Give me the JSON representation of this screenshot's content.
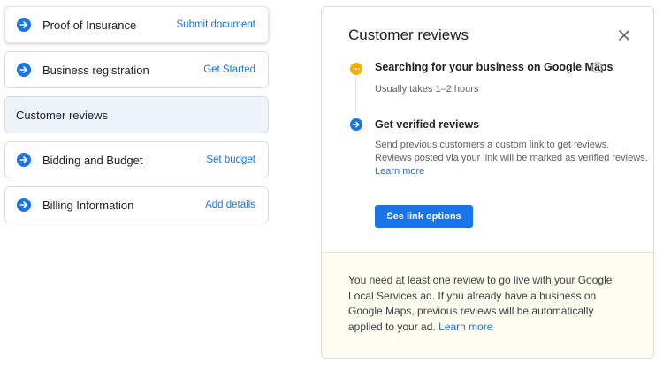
{
  "steps": [
    {
      "label": "Proof of Insurance",
      "action": "Submit document",
      "icon": "arrow-right-circle-icon"
    },
    {
      "label": "Business registration",
      "action": "Get Started",
      "icon": "arrow-right-circle-icon"
    },
    {
      "label": "Customer reviews",
      "action": ""
    },
    {
      "label": "Bidding and Budget",
      "action": "Set budget",
      "icon": "arrow-right-circle-icon"
    },
    {
      "label": "Billing Information",
      "action": "Add details",
      "icon": "arrow-right-circle-icon"
    }
  ],
  "panel": {
    "title": "Customer reviews",
    "close_icon": "close-icon",
    "searching": {
      "title": "Searching for your business on Google Maps",
      "subtitle": "Usually takes 1–2 hours",
      "icon": "pending-dots-icon",
      "help_icon": "help-circle-icon"
    },
    "verify": {
      "title": "Get verified reviews",
      "desc_line1": "Send previous customers a custom link to get reviews.",
      "desc_line2": "Reviews posted via your link will be marked as verified reviews.",
      "learn_more": "Learn more",
      "icon": "arrow-right-circle-icon"
    },
    "button_label": "See link options",
    "notice": {
      "line1": "You need at least one review to go live with your Google",
      "line2": "Local Services ad. If you already have a business on",
      "line3": "Google Maps, previous reviews will be automatically",
      "line4": "applied to your ad.",
      "learn_more": "Learn more"
    }
  },
  "colors": {
    "accent": "#1a73e8",
    "pending": "#f9ab00",
    "active_step_bg": "#eef3fb",
    "notice_bg": "#fefdf1"
  }
}
